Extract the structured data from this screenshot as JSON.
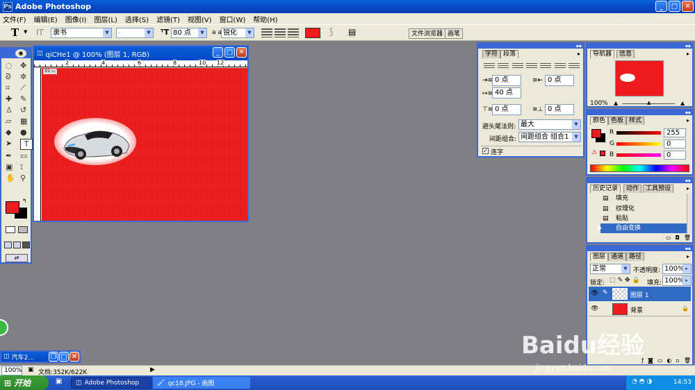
{
  "app": {
    "title": "Adobe Photoshop"
  },
  "menu": [
    "文件(F)",
    "编辑(E)",
    "图像(I)",
    "图层(L)",
    "选择(S)",
    "滤镜(T)",
    "视图(V)",
    "窗口(W)",
    "帮助(H)"
  ],
  "options": {
    "tool_glyph": "T",
    "font_family": "隶书",
    "font_style": "-",
    "font_size": "80 点",
    "aa_label": "a a",
    "antialias": "锐化",
    "right_tabs": [
      "文件浏览器",
      "画笔"
    ]
  },
  "document": {
    "title": "qiCHe1 @ 100% (图层 1, RGB)",
    "ruler_labels": [
      "2",
      "4",
      "6",
      "8",
      "10",
      "12"
    ],
    "canvas_color": "#ee1c1c"
  },
  "paragraph": {
    "tabs": [
      "字符",
      "段落"
    ],
    "indent_left": "0 点",
    "indent_right": "0 点",
    "first_line": "40 点",
    "space_before": "0 点",
    "space_after": "0 点",
    "kinsoku_label": "避头尾法则:",
    "kinsoku_value": "最大",
    "mojikumi_label": "间距组合:",
    "mojikumi_value": "间距组合 组合1",
    "hyphenate_label": "连字"
  },
  "navigator": {
    "tabs": [
      "导航器",
      "信息"
    ],
    "zoom": "100%"
  },
  "color": {
    "tabs": [
      "颜色",
      "色板",
      "样式"
    ],
    "r_label": "R",
    "g_label": "G",
    "b_label": "B",
    "r": "255",
    "g": "0",
    "b": "0",
    "fg": "#ee1c1c"
  },
  "history": {
    "tabs": [
      "历史记录",
      "动作",
      "工具预设"
    ],
    "items": [
      "填充",
      "纹理化",
      "粘贴",
      "自由变换"
    ]
  },
  "layers": {
    "tabs": [
      "图层",
      "通道",
      "路径"
    ],
    "blend": "正常",
    "opacity_label": "不透明度:",
    "opacity": "100%",
    "lock_label": "锁定:",
    "fill_label": "填充:",
    "fill": "100%",
    "items": [
      "图层 1",
      "背景"
    ]
  },
  "minimized": {
    "title": "汽车2..."
  },
  "status": {
    "zoom": "100%",
    "doc": "文档:352K/622K"
  },
  "taskbar": {
    "start": "开始",
    "items": [
      "Adobe Photoshop",
      "qc18.JPG - 画图"
    ],
    "clock": "14:53"
  },
  "watermark": {
    "logo": "Baidu经验",
    "url": "jingyan.baidu.com"
  }
}
